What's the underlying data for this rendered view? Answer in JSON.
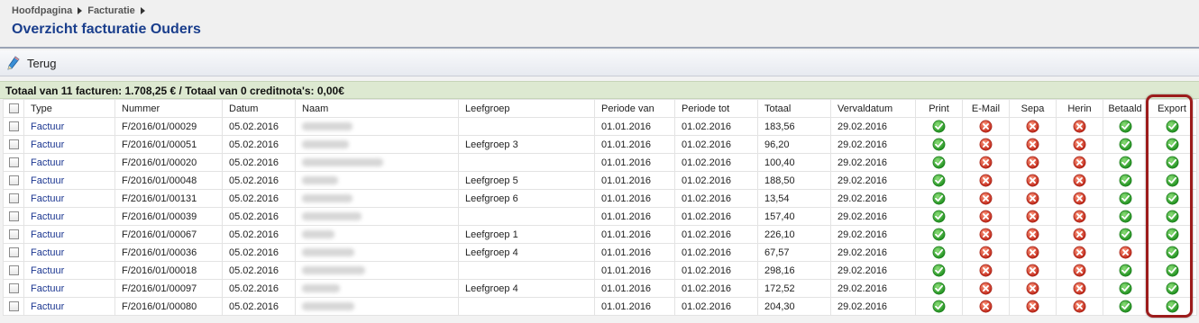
{
  "breadcrumb": {
    "items": [
      "Hoofdpagina",
      "Facturatie"
    ]
  },
  "page_title": "Overzicht facturatie Ouders",
  "toolbar": {
    "back_label": "Terug",
    "back_icon": "pencil-icon"
  },
  "summary": "Totaal van 11 facturen:  1.708,25 € / Totaal van 0 creditnota's:  0,00€",
  "columns": [
    "Type",
    "Nummer",
    "Datum",
    "Naam",
    "Leefgroep",
    "Periode van",
    "Periode tot",
    "Totaal",
    "Vervaldatum",
    "Print",
    "E-Mail",
    "Sepa",
    "Herin",
    "Betaald",
    "Export"
  ],
  "colors": {
    "ok": "#2aa52a",
    "error": "#d23a2a",
    "highlight": "#9c1c1c",
    "link": "#1a3590",
    "title": "#1a3e8c"
  },
  "rows": [
    {
      "type": "Factuur",
      "nummer": "F/2016/01/00029",
      "datum": "05.02.2016",
      "leefgroep": "",
      "van": "01.01.2016",
      "tot": "01.02.2016",
      "totaal": "183,56",
      "verval": "29.02.2016",
      "print": "ok",
      "email": "error",
      "sepa": "error",
      "herin": "error",
      "betaald": "ok",
      "export": "ok"
    },
    {
      "type": "Factuur",
      "nummer": "F/2016/01/00051",
      "datum": "05.02.2016",
      "leefgroep": "Leefgroep 3",
      "van": "01.01.2016",
      "tot": "01.02.2016",
      "totaal": "96,20",
      "verval": "29.02.2016",
      "print": "ok",
      "email": "error",
      "sepa": "error",
      "herin": "error",
      "betaald": "ok",
      "export": "ok"
    },
    {
      "type": "Factuur",
      "nummer": "F/2016/01/00020",
      "datum": "05.02.2016",
      "leefgroep": "",
      "van": "01.01.2016",
      "tot": "01.02.2016",
      "totaal": "100,40",
      "verval": "29.02.2016",
      "print": "ok",
      "email": "error",
      "sepa": "error",
      "herin": "error",
      "betaald": "ok",
      "export": "ok"
    },
    {
      "type": "Factuur",
      "nummer": "F/2016/01/00048",
      "datum": "05.02.2016",
      "leefgroep": "Leefgroep 5",
      "van": "01.01.2016",
      "tot": "01.02.2016",
      "totaal": "188,50",
      "verval": "29.02.2016",
      "print": "ok",
      "email": "error",
      "sepa": "error",
      "herin": "error",
      "betaald": "ok",
      "export": "ok"
    },
    {
      "type": "Factuur",
      "nummer": "F/2016/01/00131",
      "datum": "05.02.2016",
      "leefgroep": "Leefgroep 6",
      "van": "01.01.2016",
      "tot": "01.02.2016",
      "totaal": "13,54",
      "verval": "29.02.2016",
      "print": "ok",
      "email": "error",
      "sepa": "error",
      "herin": "error",
      "betaald": "ok",
      "export": "ok"
    },
    {
      "type": "Factuur",
      "nummer": "F/2016/01/00039",
      "datum": "05.02.2016",
      "leefgroep": "",
      "van": "01.01.2016",
      "tot": "01.02.2016",
      "totaal": "157,40",
      "verval": "29.02.2016",
      "print": "ok",
      "email": "error",
      "sepa": "error",
      "herin": "error",
      "betaald": "ok",
      "export": "ok"
    },
    {
      "type": "Factuur",
      "nummer": "F/2016/01/00067",
      "datum": "05.02.2016",
      "leefgroep": "Leefgroep 1",
      "van": "01.01.2016",
      "tot": "01.02.2016",
      "totaal": "226,10",
      "verval": "29.02.2016",
      "print": "ok",
      "email": "error",
      "sepa": "error",
      "herin": "error",
      "betaald": "ok",
      "export": "ok"
    },
    {
      "type": "Factuur",
      "nummer": "F/2016/01/00036",
      "datum": "05.02.2016",
      "leefgroep": "Leefgroep 4",
      "van": "01.01.2016",
      "tot": "01.02.2016",
      "totaal": "67,57",
      "verval": "29.02.2016",
      "print": "ok",
      "email": "error",
      "sepa": "error",
      "herin": "error",
      "betaald": "error",
      "export": "ok"
    },
    {
      "type": "Factuur",
      "nummer": "F/2016/01/00018",
      "datum": "05.02.2016",
      "leefgroep": "",
      "van": "01.01.2016",
      "tot": "01.02.2016",
      "totaal": "298,16",
      "verval": "29.02.2016",
      "print": "ok",
      "email": "error",
      "sepa": "error",
      "herin": "error",
      "betaald": "ok",
      "export": "ok"
    },
    {
      "type": "Factuur",
      "nummer": "F/2016/01/00097",
      "datum": "05.02.2016",
      "leefgroep": "Leefgroep 4",
      "van": "01.01.2016",
      "tot": "01.02.2016",
      "totaal": "172,52",
      "verval": "29.02.2016",
      "print": "ok",
      "email": "error",
      "sepa": "error",
      "herin": "error",
      "betaald": "ok",
      "export": "ok"
    },
    {
      "type": "Factuur",
      "nummer": "F/2016/01/00080",
      "datum": "05.02.2016",
      "leefgroep": "",
      "van": "01.01.2016",
      "tot": "01.02.2016",
      "totaal": "204,30",
      "verval": "29.02.2016",
      "print": "ok",
      "email": "error",
      "sepa": "error",
      "herin": "error",
      "betaald": "ok",
      "export": "ok"
    }
  ]
}
